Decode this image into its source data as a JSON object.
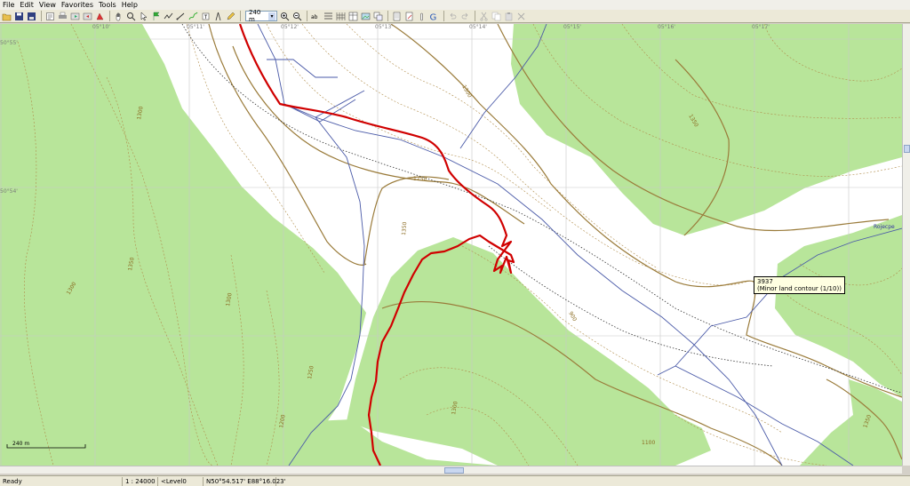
{
  "menu": {
    "items": [
      {
        "label": "File"
      },
      {
        "label": "Edit"
      },
      {
        "label": "View"
      },
      {
        "label": "Favorites"
      },
      {
        "label": "Tools"
      },
      {
        "label": "Help"
      }
    ]
  },
  "toolbar": {
    "scale_value": "240 m",
    "scale_arrow": "▾"
  },
  "map": {
    "tooltip": {
      "line1": "3937",
      "line2": "(Minor land contour (1/10))"
    },
    "scale_bar_label": "240 m",
    "road_label": "Rojecpe",
    "grid_labels": {
      "top": [
        "05°10'",
        "05°11'",
        "05°12'",
        "05°13'",
        "05°14'",
        "05°15'",
        "05°16'",
        "05°17'"
      ],
      "left": [
        "50°55'",
        "50°54'"
      ]
    },
    "elevations": [
      "1300",
      "1350",
      "1300",
      "1350",
      "1300",
      "1250",
      "1350",
      "1300",
      "1250",
      "900",
      "1200",
      "1300",
      "1100",
      "1350"
    ],
    "colors": {
      "forest": "#b8e59a",
      "contour_major": "#9a7b3a",
      "contour_minor": "#b08c4a",
      "track": "#d00000",
      "road": "#4a5aa8",
      "grid": "#c8c8c8"
    }
  },
  "status": {
    "ready": "Ready",
    "scale": "1 : 24000",
    "level": "<Level0",
    "coords": "N50°54.517' E88°16.023'"
  }
}
